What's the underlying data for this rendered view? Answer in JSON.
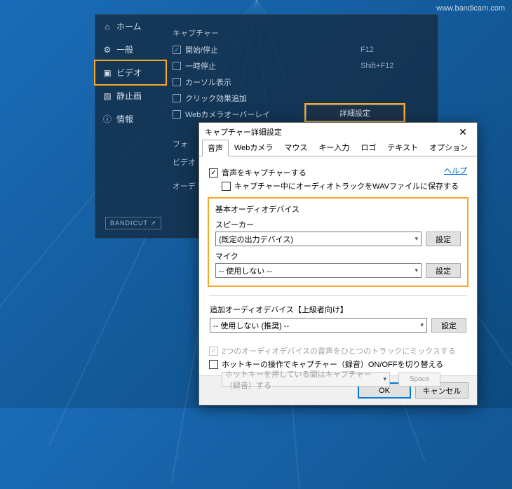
{
  "watermark": "www.bandicam.com",
  "sidebar": {
    "items": [
      {
        "label": "ホーム"
      },
      {
        "label": "一般"
      },
      {
        "label": "ビデオ"
      },
      {
        "label": "静止画"
      },
      {
        "label": "情報"
      }
    ]
  },
  "capture_section": {
    "title": "キャプチャー",
    "rows": [
      {
        "label": "開始/停止",
        "checked": true,
        "value": "F12"
      },
      {
        "label": "一時停止",
        "checked": false,
        "value": "Shift+F12"
      },
      {
        "label": "カーソル表示",
        "checked": false
      },
      {
        "label": "クリック効果追加",
        "checked": false
      },
      {
        "label": "Webカメラオーバーレイ",
        "checked": false
      }
    ],
    "detail_button": "詳細設定"
  },
  "other_labels": {
    "format": "フォ",
    "video": "ビデオ",
    "audio": "オーデ"
  },
  "bandicut": "BANDICUT ↗",
  "dialog": {
    "title": "キャプチャー詳細設定",
    "tabs": [
      "音声",
      "Webカメラ",
      "マウス",
      "キー入力",
      "ロゴ",
      "テキスト",
      "オプション"
    ],
    "active_tab": 0,
    "help": "ヘルプ",
    "capture_audio": {
      "label": "音声をキャプチャーする",
      "checked": true
    },
    "save_wav": {
      "label": "キャプチャー中にオーディオトラックをWAVファイルに保存する",
      "checked": false
    },
    "basic": {
      "title": "基本オーディオデバイス",
      "speaker_label": "スピーカー",
      "speaker_value": "(既定の出力デバイス)",
      "mic_label": "マイク",
      "mic_value": "-- 使用しない --",
      "settings_btn": "設定"
    },
    "additional": {
      "title": "追加オーディオデバイス【上級者向け】",
      "value": "-- 使用しない (推奨) --",
      "settings_btn": "設定"
    },
    "mix": {
      "label": "2つのオーディオデバイスの音声をひとつのトラックにミックスする",
      "checked": true
    },
    "hotkey_toggle": {
      "label": "ホットキーの操作でキャプチャー（録音）ON/OFFを切り替える",
      "checked": false
    },
    "hotkey_mode": {
      "label": "ホットキーを押している間はキャプチャー（録音）する",
      "key": "Space"
    },
    "ok": "OK",
    "cancel": "キャンセル"
  }
}
